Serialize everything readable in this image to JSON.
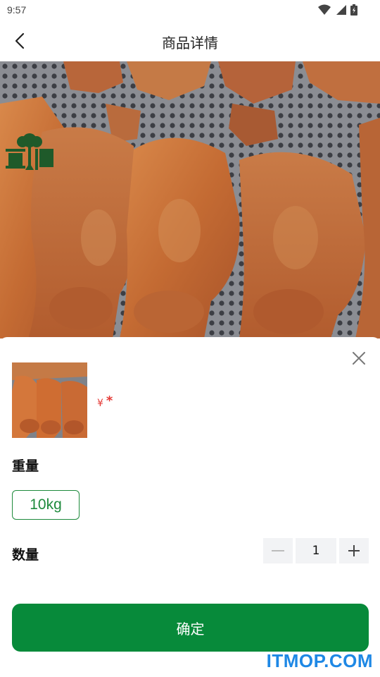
{
  "status_bar": {
    "time": "9:57"
  },
  "header": {
    "title": "商品详情"
  },
  "brand": {
    "logo_text": "惠根"
  },
  "sheet": {
    "price_currency": "¥",
    "price_value": "*",
    "weight": {
      "label": "重量",
      "options": [
        "10kg"
      ],
      "selected": "10kg"
    },
    "quantity": {
      "label": "数量",
      "value": "1"
    },
    "confirm_label": "确定"
  },
  "watermark": "ITMOP.COM",
  "colors": {
    "accent_green": "#078a3a",
    "price_red": "#e53935"
  },
  "icons": [
    "wifi-icon",
    "signal-icon",
    "battery-icon",
    "back-arrow-icon",
    "close-icon",
    "minus-icon",
    "plus-icon"
  ]
}
